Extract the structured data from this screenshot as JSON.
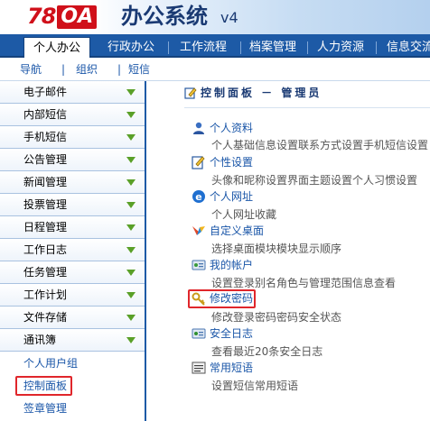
{
  "header": {
    "logo_num": "78",
    "logo_oa": "OA",
    "title": "办公系统",
    "version": "v4"
  },
  "mainnav": {
    "tabs": [
      {
        "label": "个人办公",
        "active": true
      },
      {
        "label": "行政办公",
        "active": false
      },
      {
        "label": "工作流程",
        "active": false
      },
      {
        "label": "档案管理",
        "active": false
      },
      {
        "label": "人力资源",
        "active": false
      },
      {
        "label": "信息交流",
        "active": false
      }
    ]
  },
  "subnav": {
    "items": [
      "导航",
      "组织",
      "短信"
    ],
    "separator": "|"
  },
  "sidebar": {
    "menus": [
      "电子邮件",
      "内部短信",
      "手机短信",
      "公告管理",
      "新闻管理",
      "投票管理",
      "日程管理",
      "工作日志",
      "任务管理",
      "工作计划",
      "文件存储",
      "通讯簿"
    ],
    "links": [
      "个人用户组",
      "控制面板",
      "签章管理"
    ]
  },
  "content": {
    "title": "控制面板 － 管理员",
    "entries": [
      {
        "title": "个人资料",
        "desc": "个人基础信息设置联系方式设置手机短信设置",
        "icon": "user-icon"
      },
      {
        "title": "个性设置",
        "desc": "头像和昵称设置界面主题设置个人习惯设置",
        "icon": "edit-icon"
      },
      {
        "title": "个人网址",
        "desc": "个人网址收藏",
        "icon": "ie-browser-icon"
      },
      {
        "title": "自定义桌面",
        "desc": "选择桌面模块模块显示顺序",
        "icon": "desktop-icon"
      },
      {
        "title": "我的帐户",
        "desc": "设置登录别名角色与管理范围信息查看",
        "icon": "account-icon"
      },
      {
        "title": "修改密码",
        "desc": "修改登录密码密码安全状态",
        "icon": "key-icon"
      },
      {
        "title": "安全日志",
        "desc": "查看最近20条安全日志",
        "icon": "security-log-icon"
      },
      {
        "title": "常用短语",
        "desc": "设置短信常用短语",
        "icon": "phrases-icon"
      }
    ]
  },
  "colors": {
    "nav_blue": "#1d5aa6",
    "link_blue": "#1a56a8",
    "arrow_green": "#5aa028",
    "highlight_red": "#e0262b",
    "logo_red": "#d0101a"
  }
}
